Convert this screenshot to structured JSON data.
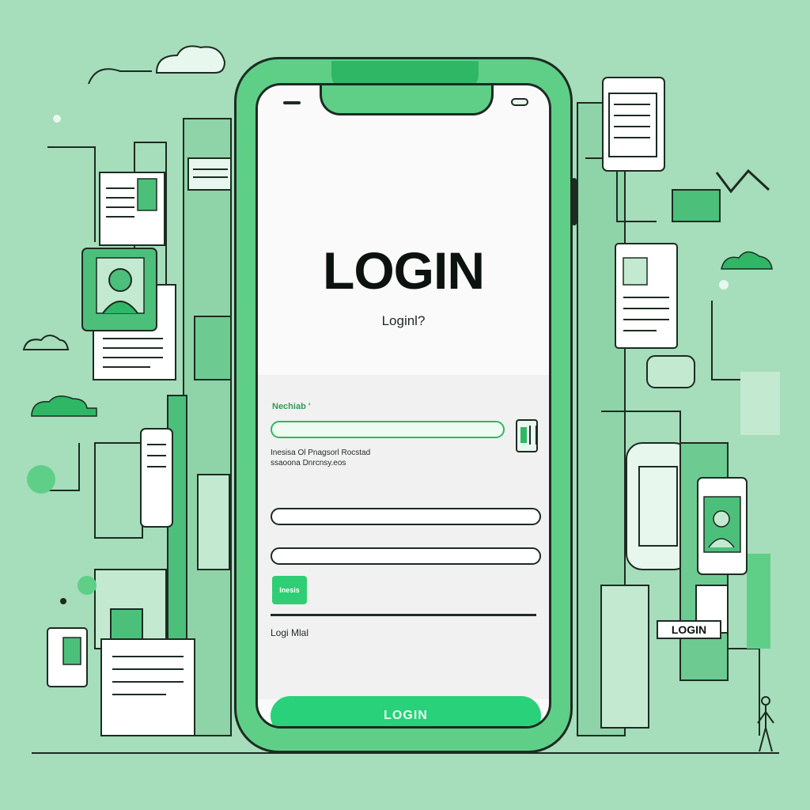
{
  "screen": {
    "title": "LOGIN",
    "subtitle": "Loginl?",
    "field_label": "Nechiab '",
    "notice_line_1": "Inesisa Ol Pnagsorl Rocstad",
    "notice_line_2": "ssaoona Dnrcnsy.eos",
    "small_button_label": "Inesis",
    "link_text": "Logi Mlal",
    "login_button_label": "LOGIN"
  },
  "background": {
    "sign_label": "LOGIN"
  },
  "colors": {
    "background": "#a6ddbb",
    "phone_body": "#5fcf88",
    "accent": "#29d17a",
    "outline": "#1d2b22"
  }
}
